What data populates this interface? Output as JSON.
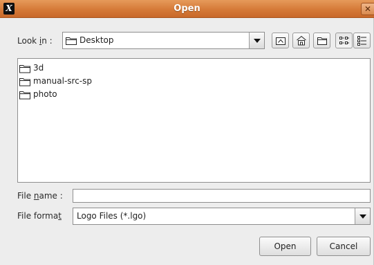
{
  "window": {
    "title": "Open",
    "app_icon_glyph": "X",
    "close_glyph": "✕"
  },
  "look_in": {
    "label_prefix": "Look ",
    "label_mnemonic": "i",
    "label_suffix": "n :",
    "selected": "Desktop"
  },
  "toolbar": {
    "buttons": [
      {
        "name": "up-one-level-icon"
      },
      {
        "name": "home-icon"
      },
      {
        "name": "new-folder-icon"
      },
      {
        "name": "list-view-icon",
        "pressed": true
      },
      {
        "name": "details-view-icon"
      }
    ]
  },
  "files": [
    {
      "name": "3d",
      "type": "folder"
    },
    {
      "name": "manual-src-sp",
      "type": "folder"
    },
    {
      "name": "photo",
      "type": "folder"
    }
  ],
  "file_name": {
    "label_prefix": "File ",
    "label_mnemonic": "n",
    "label_suffix": "ame :",
    "value": ""
  },
  "file_format": {
    "label_prefix": "File forma",
    "label_mnemonic": "t",
    "label_suffix": "",
    "selected": "Logo Files (*.lgo)"
  },
  "buttons": {
    "open": "Open",
    "cancel": "Cancel"
  },
  "colors": {
    "titlebar": "#d57a38",
    "dialog_bg": "#ededed"
  }
}
